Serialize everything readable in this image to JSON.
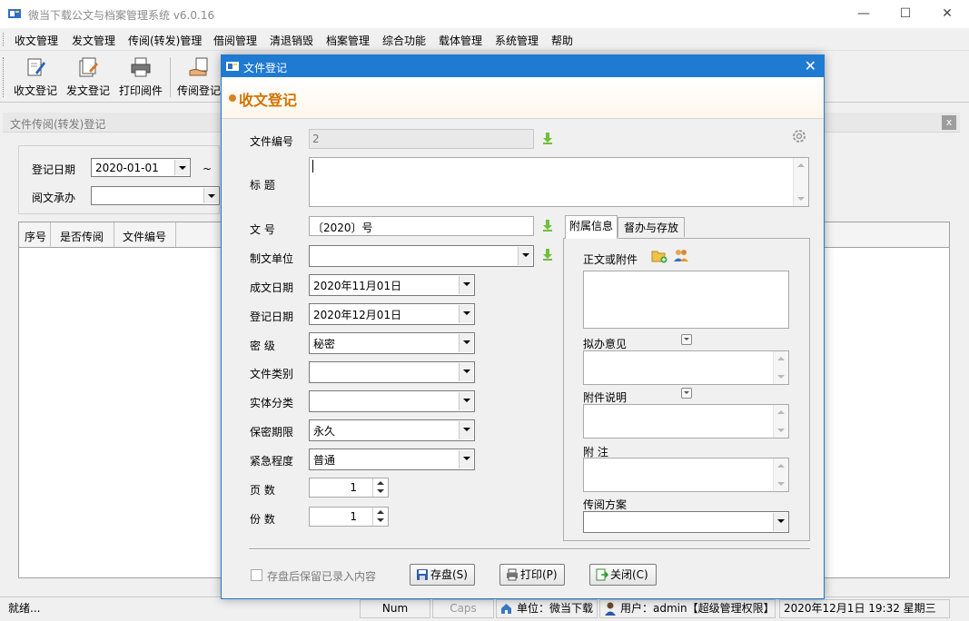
{
  "app": {
    "title": "微当下载公文与档案管理系统 v6.0.16"
  },
  "menu": [
    "收文管理",
    "发文管理",
    "传阅(转发)管理",
    "借阅管理",
    "清退销毁",
    "档案管理",
    "综合功能",
    "载体管理",
    "系统管理",
    "帮助"
  ],
  "toolbar": [
    "收文登记",
    "发文登记",
    "打印阅件",
    "传阅登记"
  ],
  "panel": {
    "title": "文件传阅(转发)登记",
    "close": "x",
    "filter": {
      "date_label": "登记日期",
      "date_value": "2020-01-01",
      "tilde": "~",
      "handler_label": "阅文承办",
      "handler_value": ""
    },
    "grid_columns": [
      "序号",
      "是否传阅",
      "文件编号"
    ]
  },
  "status": {
    "ready": "就绪...",
    "num": "Num",
    "caps": "Caps",
    "unit": "单位：微当下载",
    "user": "用户：admin【超级管理权限】",
    "datetime": "2020年12月1日 19:32 星期三"
  },
  "dialog": {
    "title": "文件登记",
    "banner": "收文登记",
    "fields": {
      "doc_no_label": "文件编号",
      "doc_no_value": "2",
      "title_label": "标  题",
      "title_value": "",
      "wenhao_label": "文  号",
      "wenhao_value": "〔2020〕号",
      "issuer_label": "制文单位",
      "issuer_value": "",
      "made_date_label": "成文日期",
      "made_date_value": "2020年11月01日",
      "reg_date_label": "登记日期",
      "reg_date_value": "2020年12月01日",
      "secret_label": "密  级",
      "secret_value": "秘密",
      "category_label": "文件类别",
      "category_value": "",
      "entity_label": "实体分类",
      "entity_value": "",
      "period_label": "保密期限",
      "period_value": "永久",
      "urgency_label": "紧急程度",
      "urgency_value": "普通",
      "pages_label": "页  数",
      "pages_value": "1",
      "copies_label": "份  数",
      "copies_value": "1"
    },
    "tabs": [
      "附属信息",
      "督办与存放"
    ],
    "attach": {
      "body_label": "正文或附件",
      "opinion_label": "拟办意见",
      "attach_note_label": "附件说明",
      "remark_label": "附  注",
      "route_label": "传阅方案",
      "route_value": ""
    },
    "keep_checkbox": "存盘后保留已录入内容",
    "buttons": {
      "save": "存盘(S)",
      "print": "打印(P)",
      "close": "关闭(C)"
    }
  }
}
